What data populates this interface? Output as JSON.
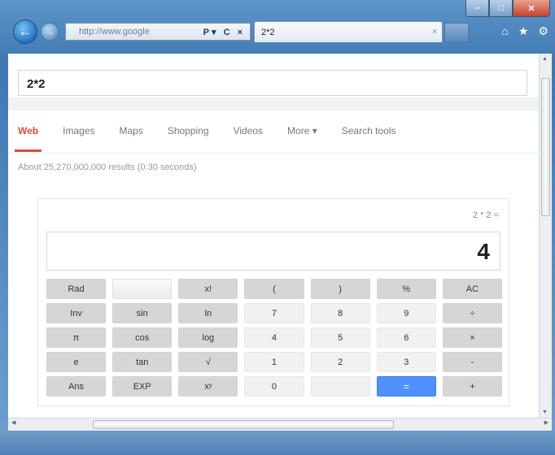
{
  "browser": {
    "address_url": "http://www.google",
    "address_controls": "P▾ C ×",
    "tab_title": "2*2",
    "tab_close": "×",
    "home_icon": "home-icon",
    "favorites_icon": "star-icon",
    "settings_icon": "gear-icon"
  },
  "search": {
    "query": "2*2"
  },
  "tabs": [
    {
      "label": "Web"
    },
    {
      "label": "Images"
    },
    {
      "label": "Maps"
    },
    {
      "label": "Shopping"
    },
    {
      "label": "Videos"
    },
    {
      "label": "More ▾"
    },
    {
      "label": "Search tools"
    }
  ],
  "result_stats": "About 25,270,000,000 results (0.30 seconds)",
  "calculator": {
    "history": "2 * 2 =",
    "display": "4",
    "rows": [
      [
        "Rad",
        "",
        "x!",
        "(",
        ")",
        "%",
        "AC"
      ],
      [
        "Inv",
        "sin",
        "ln",
        "7",
        "8",
        "9",
        "÷"
      ],
      [
        "π",
        "cos",
        "log",
        "4",
        "5",
        "6",
        "×"
      ],
      [
        "e",
        "tan",
        "√",
        "1",
        "2",
        "3",
        "-"
      ],
      [
        "Ans",
        "EXP",
        "xʸ",
        "0",
        "",
        "=",
        "+"
      ]
    ]
  }
}
